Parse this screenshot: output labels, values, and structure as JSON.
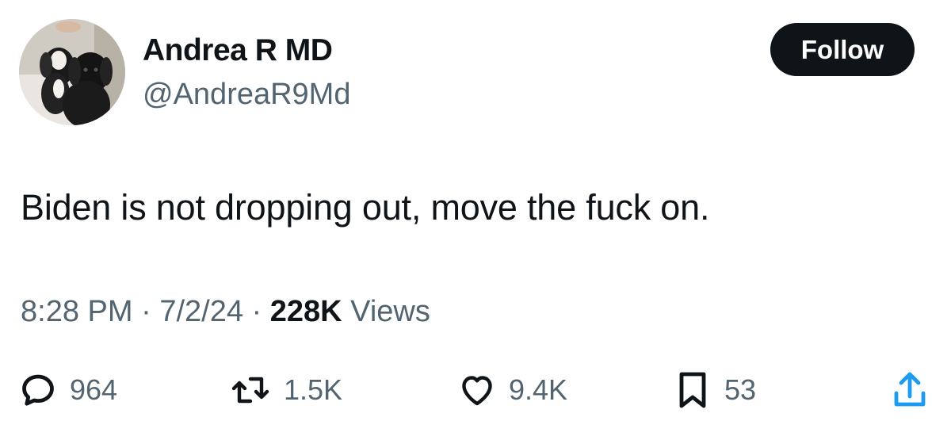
{
  "user": {
    "name": "Andrea R MD",
    "handle": "@AndreaR9Md"
  },
  "follow_label": "Follow",
  "tweet": {
    "text": "Biden is not dropping out, move the fuck on.",
    "time": "8:28 PM",
    "separator": "·",
    "date": "7/2/24",
    "views_count": "228K",
    "views_label": "Views"
  },
  "actions": {
    "replies": "964",
    "retweets": "1.5K",
    "likes": "9.4K",
    "bookmarks": "53"
  },
  "icons": {
    "reply": "speech-bubble-icon",
    "retweet": "retweet-arrows-icon",
    "like": "heart-icon",
    "bookmark": "bookmark-icon",
    "share": "share-upload-icon"
  },
  "colors": {
    "text_primary": "#0f1419",
    "text_secondary": "#536471",
    "button_bg": "#0f1419",
    "button_text": "#ffffff"
  }
}
